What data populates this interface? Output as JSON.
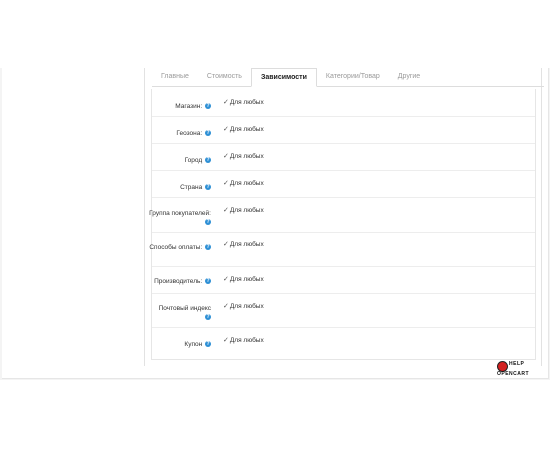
{
  "tabs": [
    {
      "label": "Главные",
      "active": false
    },
    {
      "label": "Стоимость",
      "active": false
    },
    {
      "label": "Зависимости",
      "active": true
    },
    {
      "label": "Категории/Товар",
      "active": false
    },
    {
      "label": "Другие",
      "active": false
    }
  ],
  "help_glyph": "?",
  "check_glyph": "✓",
  "rows": [
    {
      "label": "Магазин:",
      "value": "Для любых"
    },
    {
      "label": "Геозона:",
      "value": "Для любых"
    },
    {
      "label": "Город",
      "value": "Для любых"
    },
    {
      "label": "Страна",
      "value": "Для любых"
    },
    {
      "label": "Группа покупателей:",
      "value": "Для любых"
    },
    {
      "label": "Способы оплаты:",
      "value": "Для любых"
    },
    {
      "label": "Производитель:",
      "value": "Для любых"
    },
    {
      "label": "Почтовый индекс",
      "value": "Для любых"
    },
    {
      "label": "Купон",
      "value": "Для любых"
    }
  ],
  "watermark": {
    "line1": "HELP",
    "line2": "OPENCART"
  },
  "colors": {
    "help_icon": "#2d8fd5",
    "active_tab_text": "#222222",
    "inactive_tab_text": "#9a9a9a"
  }
}
